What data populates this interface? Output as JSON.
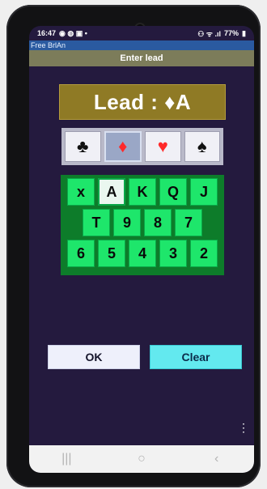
{
  "status": {
    "time": "16:47",
    "left_icons": "◉ ◍ ▣ •",
    "right_icons": "⚇ ᯤ .ıl",
    "battery": "77%",
    "battery_icon": "▮"
  },
  "app": {
    "name": "Free BrlAn",
    "title": "Enter lead"
  },
  "lead": {
    "label": "Lead : ♦A"
  },
  "suits": [
    {
      "name": "clubs",
      "glyph": "♣",
      "color": "#111111"
    },
    {
      "name": "diamonds",
      "glyph": "♦",
      "color": "#ff2a2a",
      "selected": true
    },
    {
      "name": "hearts",
      "glyph": "♥",
      "color": "#ff2a2a"
    },
    {
      "name": "spades",
      "glyph": "♠",
      "color": "#111111"
    }
  ],
  "keypad": {
    "row1": [
      "x",
      "A",
      "K",
      "Q",
      "J"
    ],
    "row2": [
      "T",
      "9",
      "8",
      "7"
    ],
    "row3": [
      "6",
      "5",
      "4",
      "3",
      "2"
    ],
    "selected": "A"
  },
  "buttons": {
    "ok": "OK",
    "clear": "Clear"
  },
  "overflow": {
    "glyph": "⋮"
  },
  "navbar": {
    "recents": "|||",
    "home": "○",
    "back": "‹"
  }
}
